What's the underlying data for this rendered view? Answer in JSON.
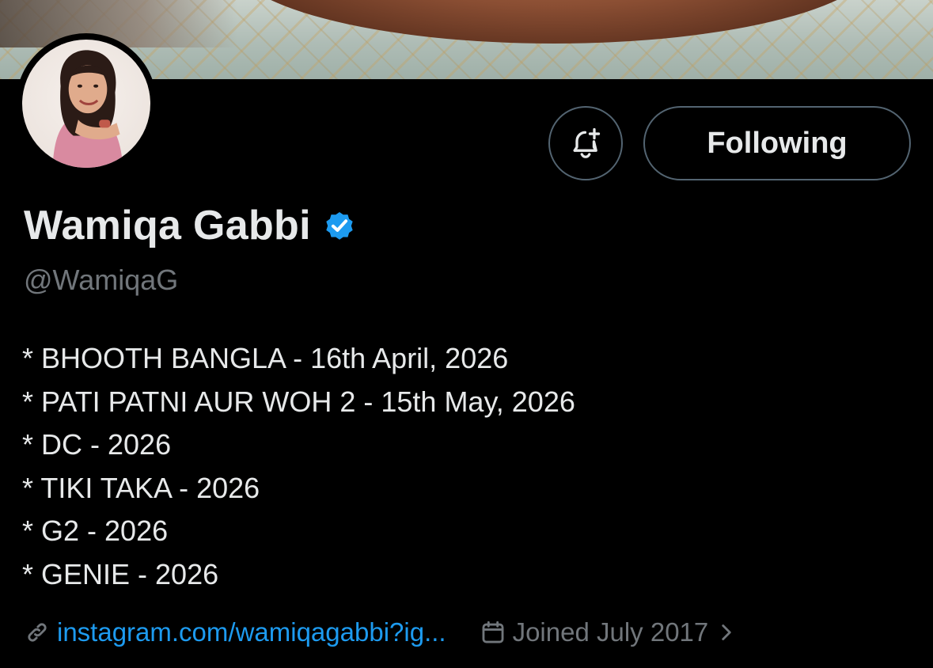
{
  "profile": {
    "name": "Wamiqa Gabbi",
    "handle": "@WamiqaG",
    "verified": true,
    "bio": [
      "* BHOOTH BANGLA - 16th April, 2026",
      "* PATI PATNI AUR WOH 2 - 15th May, 2026",
      "* DC - 2026",
      "* TIKI TAKA - 2026",
      "* G2 - 2026",
      "* GENIE - 2026"
    ],
    "link": "instagram.com/wamiqagabbi?ig...",
    "joined": "Joined July 2017"
  },
  "actions": {
    "follow_label": "Following",
    "notify_icon": "bell-plus-icon"
  },
  "icons": {
    "link": "link-icon",
    "calendar": "calendar-icon",
    "chevron": "chevron-right-icon",
    "verified": "verified-badge-icon"
  },
  "colors": {
    "background": "#000000",
    "text": "#e7e9ea",
    "muted": "#71767b",
    "link": "#1d9bf0",
    "verified": "#1d9bf0",
    "border": "#536471"
  }
}
